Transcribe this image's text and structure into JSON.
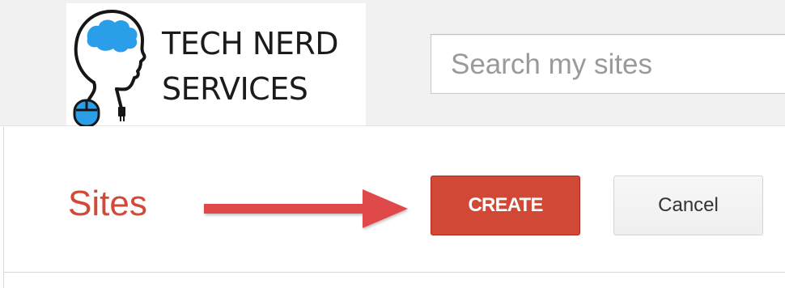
{
  "header": {
    "logo": {
      "line1": "TECH NERD",
      "line2": "SERVICES",
      "icon": "head-with-brain-and-mouse-icon"
    },
    "search": {
      "placeholder": "Search my sites",
      "value": ""
    }
  },
  "main": {
    "title": "Sites",
    "create_label": "CREATE",
    "cancel_label": "Cancel",
    "annotation_icon": "red-arrow-right-icon"
  },
  "colors": {
    "accent_red": "#d14836",
    "title_red": "#d34836",
    "arrow_red": "#e04848",
    "brain_blue": "#2a9ee8",
    "header_bg": "#f1f1f1"
  }
}
